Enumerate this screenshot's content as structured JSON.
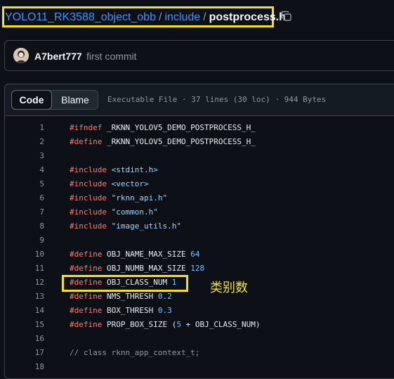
{
  "breadcrumb": {
    "repo": "YOLO11_RK3588_object_obb",
    "folder": "include",
    "separator": "/",
    "file": "postprocess.h"
  },
  "commit": {
    "author": "A7bert777",
    "message": "first commit"
  },
  "file_header": {
    "code_tab": "Code",
    "blame_tab": "Blame",
    "meta": "Executable File · 37 lines (30 loc) · 944 Bytes"
  },
  "code_lines": [
    {
      "n": "1",
      "tokens": [
        [
          "pre",
          "#ifndef"
        ],
        [
          "id",
          " _RKNN_YOLOV5_DEMO_POSTPROCESS_H_"
        ]
      ]
    },
    {
      "n": "2",
      "tokens": [
        [
          "pre",
          "#define"
        ],
        [
          "id",
          " _RKNN_YOLOV5_DEMO_POSTPROCESS_H_"
        ]
      ]
    },
    {
      "n": "3",
      "tokens": []
    },
    {
      "n": "4",
      "tokens": [
        [
          "pre",
          "#include"
        ],
        [
          "id",
          " "
        ],
        [
          "str",
          "<stdint.h>"
        ]
      ]
    },
    {
      "n": "5",
      "tokens": [
        [
          "pre",
          "#include"
        ],
        [
          "id",
          " "
        ],
        [
          "str",
          "<vector>"
        ]
      ]
    },
    {
      "n": "6",
      "tokens": [
        [
          "pre",
          "#include"
        ],
        [
          "id",
          " "
        ],
        [
          "str",
          "\"rknn_api.h\""
        ]
      ]
    },
    {
      "n": "7",
      "tokens": [
        [
          "pre",
          "#include"
        ],
        [
          "id",
          " "
        ],
        [
          "str",
          "\"common.h\""
        ]
      ]
    },
    {
      "n": "8",
      "tokens": [
        [
          "pre",
          "#include"
        ],
        [
          "id",
          " "
        ],
        [
          "str",
          "\"image_utils.h\""
        ]
      ]
    },
    {
      "n": "9",
      "tokens": []
    },
    {
      "n": "10",
      "tokens": [
        [
          "pre",
          "#define"
        ],
        [
          "id",
          " OBJ_NAME_MAX_SIZE "
        ],
        [
          "num",
          "64"
        ]
      ]
    },
    {
      "n": "11",
      "tokens": [
        [
          "pre",
          "#define"
        ],
        [
          "id",
          " OBJ_NUMB_MAX_SIZE "
        ],
        [
          "num",
          "128"
        ]
      ]
    },
    {
      "n": "12",
      "tokens": [
        [
          "pre",
          "#define"
        ],
        [
          "id",
          " OBJ_CLASS_NUM "
        ],
        [
          "num",
          "1"
        ]
      ]
    },
    {
      "n": "13",
      "tokens": [
        [
          "pre",
          "#define"
        ],
        [
          "id",
          " NMS_THRESH "
        ],
        [
          "num",
          "0.2"
        ]
      ]
    },
    {
      "n": "14",
      "tokens": [
        [
          "pre",
          "#define"
        ],
        [
          "id",
          " BOX_THRESH "
        ],
        [
          "num",
          "0.3"
        ]
      ]
    },
    {
      "n": "15",
      "tokens": [
        [
          "pre",
          "#define"
        ],
        [
          "id",
          " PROP_BOX_SIZE ("
        ],
        [
          "num",
          "5"
        ],
        [
          "id",
          " + OBJ_CLASS_NUM)"
        ]
      ]
    },
    {
      "n": "16",
      "tokens": []
    },
    {
      "n": "17",
      "tokens": [
        [
          "cm",
          "// class rknn_app_context_t;"
        ]
      ]
    },
    {
      "n": "18",
      "tokens": []
    }
  ],
  "annotation": "类别数",
  "icons": {
    "copy": "copy-icon",
    "avatar": "avatar"
  },
  "colors": {
    "highlight": "#f5e11b",
    "link": "#4493f8"
  }
}
